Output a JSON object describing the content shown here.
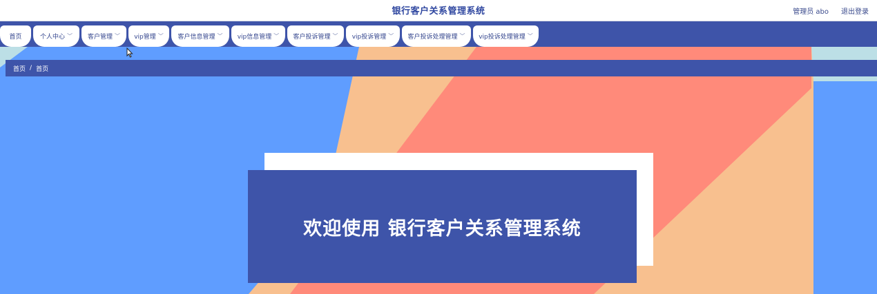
{
  "header": {
    "title": "银行客户关系管理系统",
    "user": "管理员 abo",
    "logout": "退出登录"
  },
  "nav": {
    "tabs": [
      {
        "label": "首页",
        "has_dropdown": false
      },
      {
        "label": "个人中心",
        "has_dropdown": true
      },
      {
        "label": "客户管理",
        "has_dropdown": true
      },
      {
        "label": "vip管理",
        "has_dropdown": true
      },
      {
        "label": "客户信息管理",
        "has_dropdown": true
      },
      {
        "label": "vip信息管理",
        "has_dropdown": true
      },
      {
        "label": "客户投诉管理",
        "has_dropdown": true
      },
      {
        "label": "vip投诉管理",
        "has_dropdown": true
      },
      {
        "label": "客户投诉处理管理",
        "has_dropdown": true
      },
      {
        "label": "vip投诉处理管理",
        "has_dropdown": true
      }
    ],
    "chevron": "﹀"
  },
  "breadcrumb": {
    "items": [
      "首页",
      "首页"
    ],
    "separator": "/"
  },
  "welcome": {
    "text": "欢迎使用 银行客户关系管理系统"
  },
  "colors": {
    "primary": "#3e54a9",
    "bg_blue": "#5f9dff",
    "bg_peach": "#f8c08f",
    "bg_salmon": "#ff8a7a",
    "bg_lightblue": "#bcdfe6"
  }
}
